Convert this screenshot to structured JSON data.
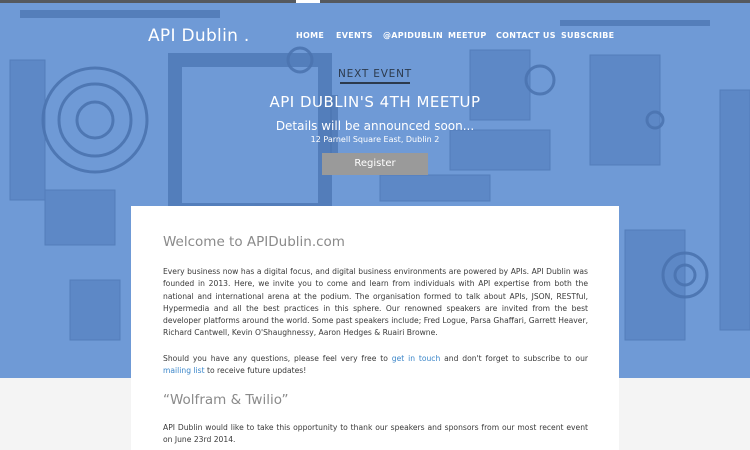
{
  "brand": "API Dublin .",
  "nav": {
    "items": [
      "HOME",
      "EVENTS",
      "@APIDUBLIN",
      "MEETUP",
      "CONTACT US",
      "SUBSCRIBE"
    ]
  },
  "hero": {
    "eyebrow": "NEXT EVENT",
    "title": "API DUBLIN'S 4TH MEETUP",
    "subtitle": "Details will be announced soon...",
    "address": "12 Parnell Square East, Dublin 2",
    "register_label": "Register"
  },
  "welcome": {
    "title": "Welcome to APIDublin.com",
    "paragraph1": "Every business now has a digital focus, and digital business environments are powered by APIs. API Dublin was founded in 2013. Here, we invite you to come and learn from individuals with API expertise from both the national and international arena at the podium. The organisation formed to talk about APIs, JSON, RESTful, Hypermedia and all the best practices in this sphere. Our renowned speakers are invited from the best developer platforms around the world. Some past speakers include; Fred Logue, Parsa Ghaffari, Garrett Heaver, Richard Cantwell, Kevin O'Shaughnessy, Aaron Hedges & Ruairi Browne.",
    "paragraph2_pre": "Should you have any questions, please feel very free to ",
    "paragraph2_link1": "get in touch",
    "paragraph2_mid": " and don't forget to subscribe to our ",
    "paragraph2_link2": "mailing list",
    "paragraph2_post": " to receive future updates!"
  },
  "section2": {
    "title": "“Wolfram & Twilio”",
    "paragraph": "API Dublin would like to take this opportunity to thank our speakers and sponsors from our most recent event on June 23rd 2014."
  },
  "colors": {
    "hero_overlay": "#6f9ad6",
    "link": "#3b86c9",
    "button": "#9a9a9a"
  }
}
